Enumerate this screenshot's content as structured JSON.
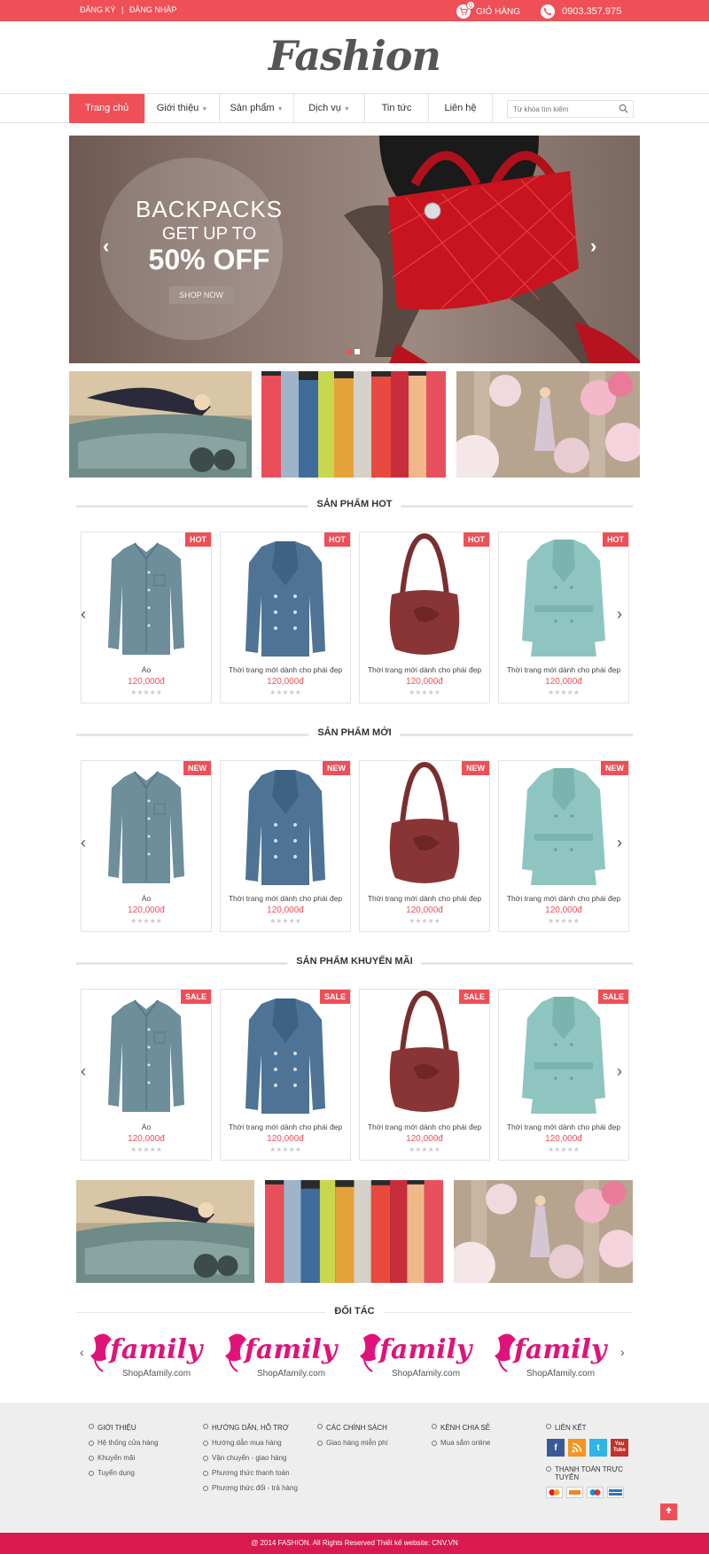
{
  "topbar": {
    "register": "ĐĂNG KÝ",
    "separator": "|",
    "login": "ĐĂNG NHẬP",
    "cart_label": "GIỎ HÀNG",
    "cart_count": "0",
    "phone": "0903.357.975"
  },
  "logo": "Fashion",
  "nav": {
    "items": [
      {
        "label": "Trang chủ",
        "dropdown": false
      },
      {
        "label": "Giới thiệu",
        "dropdown": true
      },
      {
        "label": "Sản phẩm",
        "dropdown": true
      },
      {
        "label": "Dịch vụ",
        "dropdown": true
      },
      {
        "label": "Tin tức",
        "dropdown": false
      },
      {
        "label": "Liên hệ",
        "dropdown": false
      }
    ],
    "search_placeholder": "Từ khóa tìm kiếm"
  },
  "slider": {
    "line1": "BACKPACKS",
    "line2": "GET UP TO",
    "line3": "50% OFF",
    "button": "SHOP NOW",
    "prev": "‹",
    "next": "›"
  },
  "sections": {
    "hot": {
      "title": "SẢN PHẨM HOT",
      "tag": "HOT",
      "products": [
        {
          "name": "Áo",
          "price": "120,000đ",
          "img": "shirt"
        },
        {
          "name": "Thời trang mới dành cho phái đẹp",
          "price": "120,000đ",
          "img": "coat"
        },
        {
          "name": "Thời trang mới dành cho phái đẹp",
          "price": "120,000đ",
          "img": "bag"
        },
        {
          "name": "Thời trang mới dành cho phái đẹp",
          "price": "120,000đ",
          "img": "trench"
        }
      ]
    },
    "new": {
      "title": "SẢN PHẨM MỚI",
      "tag": "NEW",
      "products": [
        {
          "name": "Áo",
          "price": "120,000đ",
          "img": "shirt"
        },
        {
          "name": "Thời trang mới dành cho phái đẹp",
          "price": "120,000đ",
          "img": "coat"
        },
        {
          "name": "Thời trang mới dành cho phái đẹp",
          "price": "120,000đ",
          "img": "bag"
        },
        {
          "name": "Thời trang mới dành cho phái đẹp",
          "price": "120,000đ",
          "img": "trench"
        }
      ]
    },
    "sale": {
      "title": "SẢN PHẨM KHUYẾN MÃI",
      "tag": "SALE",
      "products": [
        {
          "name": "Áo",
          "price": "120,000đ",
          "img": "shirt"
        },
        {
          "name": "Thời trang mới dành cho phái đẹp",
          "price": "120,000đ",
          "img": "coat"
        },
        {
          "name": "Thời trang mới dành cho phái đẹp",
          "price": "120,000đ",
          "img": "bag"
        },
        {
          "name": "Thời trang mới dành cho phái đẹp",
          "price": "120,000đ",
          "img": "trench"
        }
      ]
    }
  },
  "partners": {
    "title": "ĐỐI TÁC",
    "logo_text": "family",
    "logo_url": "ShopAfamily.com"
  },
  "footer": {
    "col1": {
      "title": "GIỚI THIỆU",
      "items": [
        "Hệ thống cửa hàng",
        "Khuyến mãi",
        "Tuyển dụng"
      ]
    },
    "col2": {
      "title": "HƯỚNG DẪN, HỖ TRỢ",
      "items": [
        "Hướng dẫn mua hàng",
        "Vận chuyển - giao hàng",
        "Phương thức thanh toán",
        "Phương thức đổi - trả hàng"
      ]
    },
    "col3": {
      "title": "CÁC CHÍNH SÁCH",
      "items": [
        "Giao hàng miễn phí"
      ]
    },
    "col4": {
      "title": "KÊNH CHIA SẺ",
      "items": [
        "Mua sắm online"
      ]
    },
    "col5": {
      "title": "LIÊN KẾT",
      "payment_title": "THANH TOÁN TRỰC TUYẾN"
    },
    "copyright": "@ 2014 FASHION. All Rights Reserved Thiết kế website: CNV.VN"
  },
  "colors": {
    "accent": "#ef4f57",
    "bottombar": "#d91a50"
  }
}
